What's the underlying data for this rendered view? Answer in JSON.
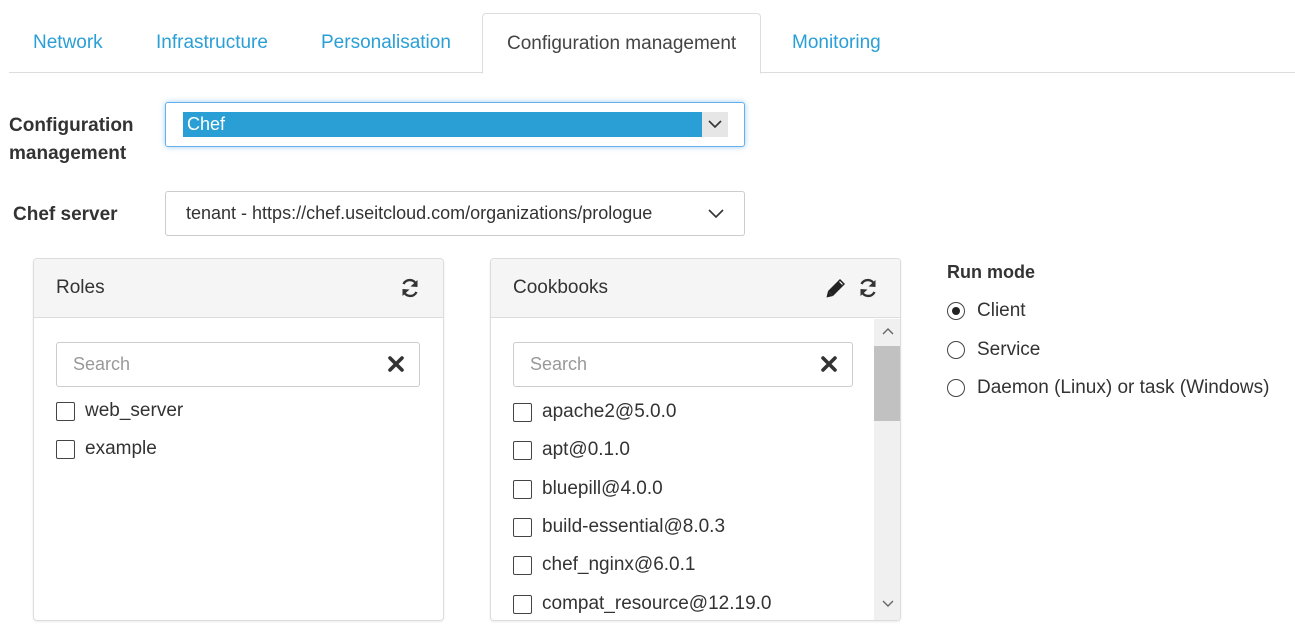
{
  "tabs": [
    {
      "label": "Network",
      "active": false
    },
    {
      "label": "Infrastructure",
      "active": false
    },
    {
      "label": "Personalisation",
      "active": false
    },
    {
      "label": "Configuration management",
      "active": true
    },
    {
      "label": "Monitoring",
      "active": false
    }
  ],
  "config_management": {
    "label": "Configuration management",
    "selected": "Chef"
  },
  "chef_server": {
    "label": "Chef server",
    "selected": "tenant - https://chef.useitcloud.com/organizations/prologue"
  },
  "roles": {
    "title": "Roles",
    "search_placeholder": "Search",
    "items": [
      {
        "label": "web_server",
        "checked": false
      },
      {
        "label": "example",
        "checked": false
      }
    ]
  },
  "cookbooks": {
    "title": "Cookbooks",
    "search_placeholder": "Search",
    "items": [
      {
        "label": "apache2@5.0.0",
        "checked": false
      },
      {
        "label": "apt@0.1.0",
        "checked": false
      },
      {
        "label": "bluepill@4.0.0",
        "checked": false
      },
      {
        "label": "build-essential@8.0.3",
        "checked": false
      },
      {
        "label": "chef_nginx@6.0.1",
        "checked": false
      },
      {
        "label": "compat_resource@12.19.0",
        "checked": false
      }
    ]
  },
  "run_mode": {
    "title": "Run mode",
    "options": [
      {
        "label": "Client",
        "checked": true
      },
      {
        "label": "Service",
        "checked": false
      },
      {
        "label": "Daemon (Linux) or task (Windows)",
        "checked": false
      }
    ]
  },
  "colors": {
    "accent": "#2a9fd6",
    "border": "#dddddd",
    "panel_header": "#f5f5f5"
  }
}
